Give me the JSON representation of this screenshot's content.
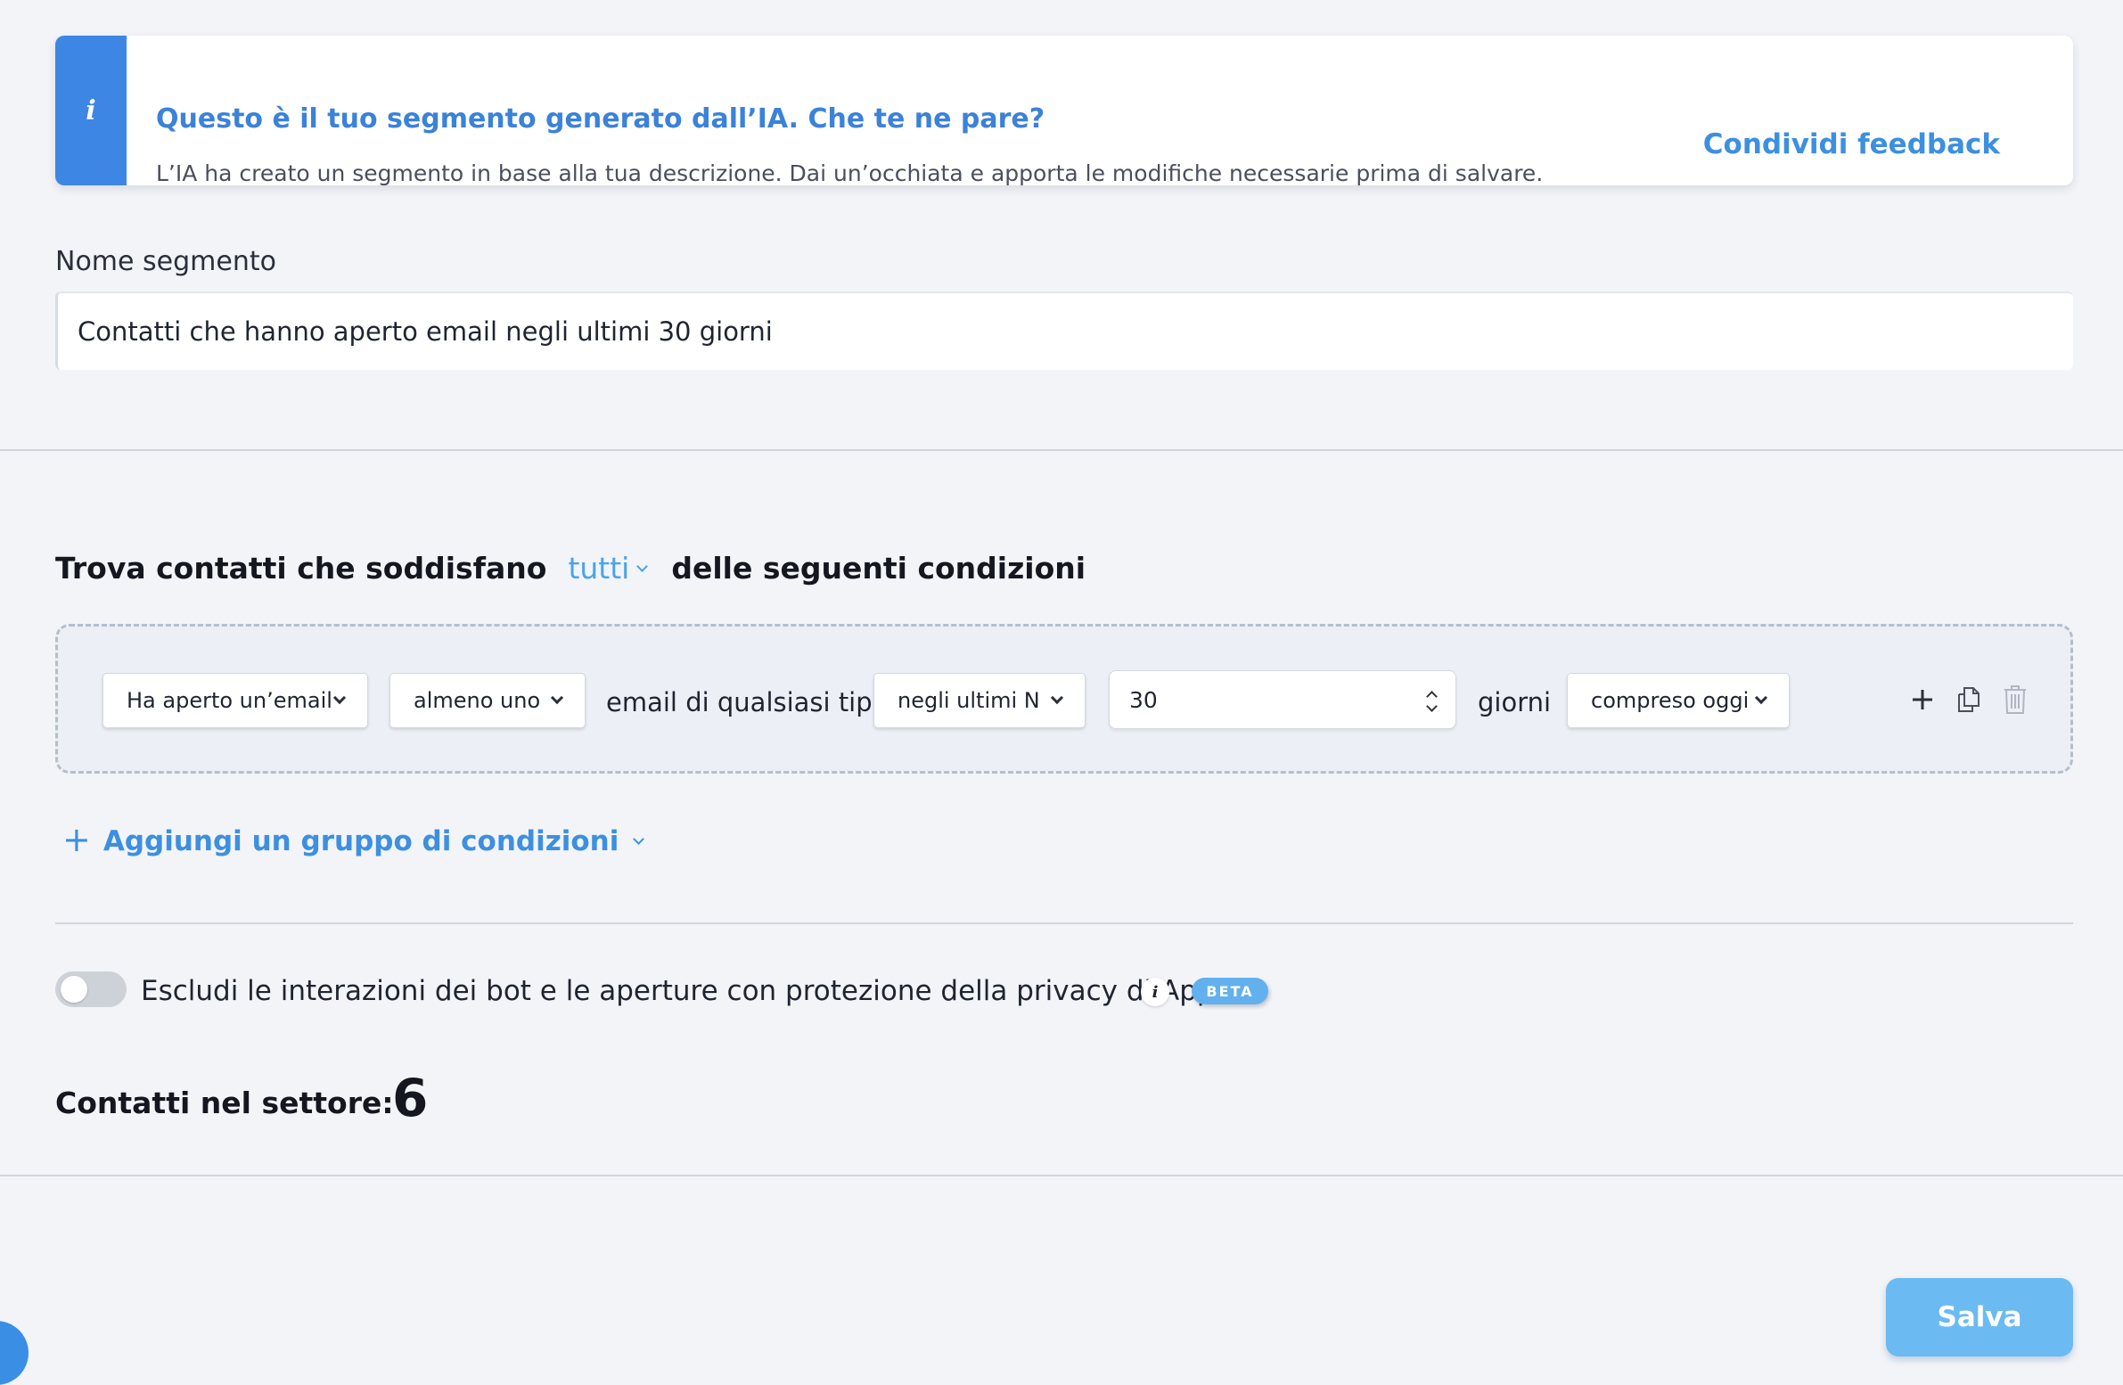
{
  "banner": {
    "icon": "info-icon",
    "title": "Questo è il tuo segmento generato dall’IA. Che te ne pare?",
    "text": "L’IA ha creato un segmento in base alla tua descrizione. Dai un’occhiata e apporta le modifiche necessarie prima di salvare.",
    "feedback_label": "Condividi feedback"
  },
  "segment": {
    "name_label": "Nome segmento",
    "name_value": "Contatti che hanno aperto email negli ultimi 30 giorni"
  },
  "conditions": {
    "heading_prefix": "Trova contatti che soddisfano",
    "match_value": "tutti",
    "heading_suffix": "delle seguenti condizioni",
    "row": {
      "event": "Ha aperto un’email",
      "quantity": "almeno uno",
      "email_type_text": "email di qualsiasi tipo",
      "period": "negli ultimi N",
      "days_value": "30",
      "days_text": "giorni",
      "include_today": "compreso oggi"
    },
    "add_group_label": "Aggiungi un gruppo di condizioni"
  },
  "bot_filter": {
    "label": "Escludi le interazioni dei bot e le aperture con protezione della privacy di Apple",
    "enabled": false,
    "badge": "BETA"
  },
  "summary": {
    "count_label": "Contatti nel settore:",
    "count_value": "6"
  },
  "actions": {
    "save_label": "Salva"
  },
  "colors": {
    "accent": "#3d8fe0",
    "banner_stripe": "#3d86e4",
    "save_button": "#6cbaf2",
    "background": "#f2f4f8"
  }
}
